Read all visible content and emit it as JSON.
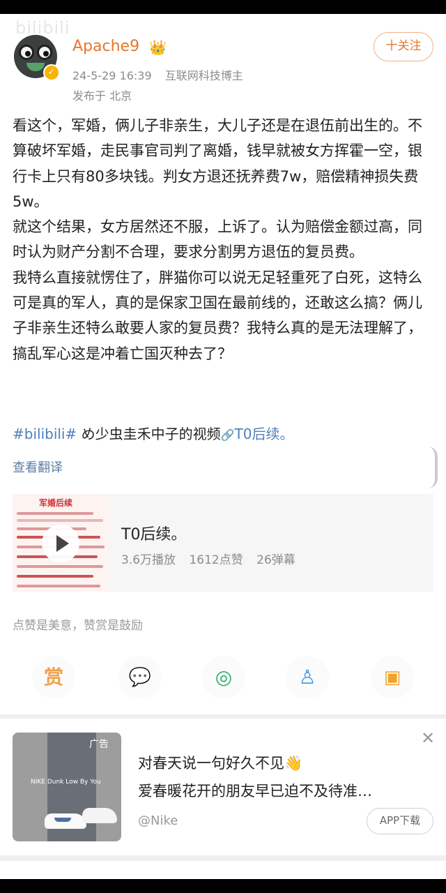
{
  "watermark": "bilibili",
  "author": {
    "name": "Apache9",
    "crown_glyph": "👑",
    "verified_glyph": "✓",
    "date": "24-5-29 16:39",
    "title": "互联网科技博主",
    "location": "发布于 北京",
    "follow_label": "十关注"
  },
  "post": {
    "paragraphs": [
      "看这个，军婚，俩儿子非亲生，大儿子还是在退伍前出生的。不算破坏军婚，走民事官司判了离婚，钱早就被女方挥霍一空，银行卡上只有80多块钱。判女方退还抚养费7w，赔偿精神损失费5w。",
      "就这个结果，女方居然还不服，上诉了。认为赔偿金额过高，同时认为财产分割不合理，要求分割男方退伍的复员费。",
      "我特么直接就愣住了，胖猫你可以说无足轻重死了白死，这特么可是真的军人，真的是保家卫国在最前线的，还敢这么搞？俩儿子非亲生还特么敢要人家的复员费？我特么真的是无法理解了，搞乱军心这是冲着亡国灭种去了？"
    ],
    "hashtag": "#bilibili#",
    "source_text": "め少虫圭禾中子的视频",
    "link_icon": "🔗",
    "link_text": "T0后续。",
    "translate_label": "查看翻译"
  },
  "video": {
    "thumb_title": "军婚后续",
    "title": "T0后续。",
    "plays": "3.6万播放",
    "likes": "1612点赞",
    "danmaku": "26弹幕"
  },
  "reward_note": "点赞是美意，赞赏是鼓励",
  "share": {
    "reward_glyph": "赏",
    "wechat_glyph": "💬",
    "moments_glyph": "◎",
    "qq_glyph": "♙",
    "save_glyph": "▣"
  },
  "ad": {
    "label": "广告",
    "image_caption": "NIKE Dunk Low By You",
    "line1": "对春天说一句好久不见👋",
    "line2": "爱春暖花开的朋友早已迫不及待准…",
    "brand": "@Nike",
    "app_button": "APP下载",
    "close_glyph": "✕"
  },
  "colors": {
    "accent_orange": "#e5772b",
    "link_blue": "#4f7fb8",
    "meta_gray": "#8c8c8c"
  }
}
